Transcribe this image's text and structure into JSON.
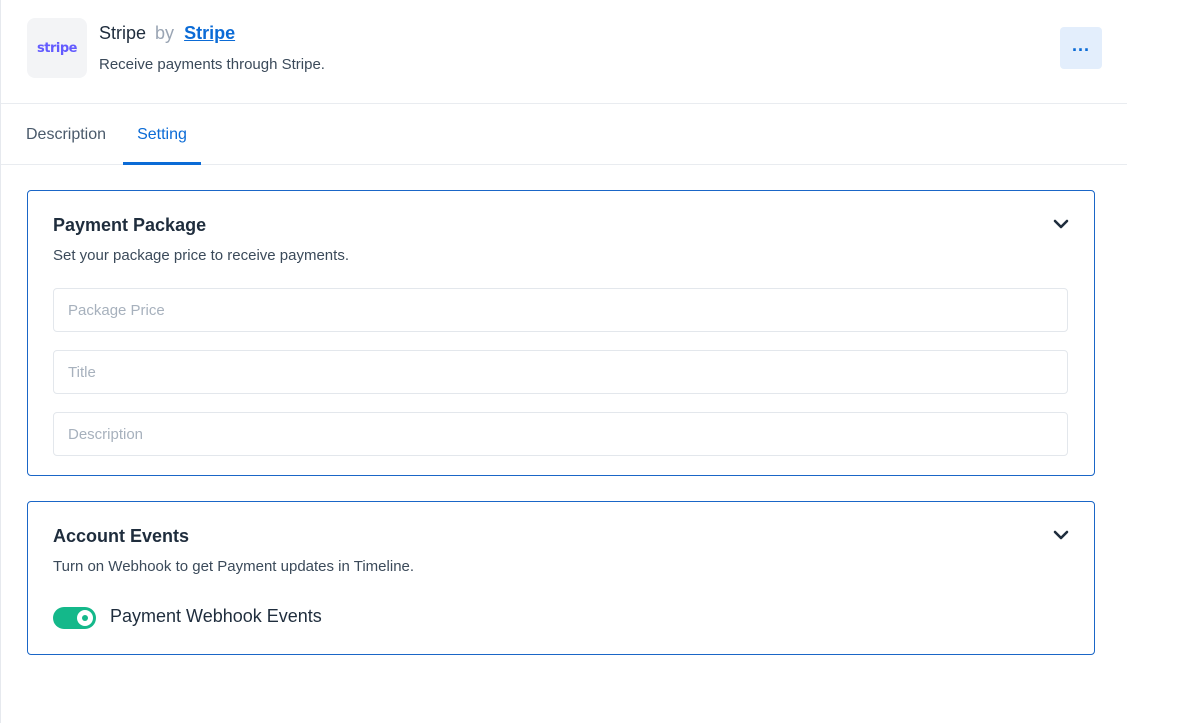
{
  "app": {
    "name": "Stripe",
    "by_label": "by",
    "author": "Stripe",
    "description": "Receive payments through Stripe.",
    "logo_text": "stripe",
    "more_label": "..."
  },
  "tabs": [
    {
      "label": "Description",
      "active": false
    },
    {
      "label": "Setting",
      "active": true
    }
  ],
  "payment_package": {
    "title": "Payment Package",
    "description": "Set your package price to receive payments.",
    "fields": [
      {
        "value": "",
        "placeholder": "Package Price"
      },
      {
        "value": "",
        "placeholder": "Title"
      },
      {
        "value": "",
        "placeholder": "Description"
      }
    ]
  },
  "account_events": {
    "title": "Account Events",
    "description": "Turn on Webhook to get Payment updates in Timeline.",
    "toggle": {
      "label": "Payment Webhook Events",
      "on": true
    }
  },
  "colors": {
    "accent": "#0b6bd6",
    "toggle_on": "#14b88a",
    "card_border": "#1a66c7",
    "stripe_brand": "#635bff"
  },
  "icons": {
    "more": "more-horizontal-icon",
    "chevron": "chevron-down-icon"
  }
}
